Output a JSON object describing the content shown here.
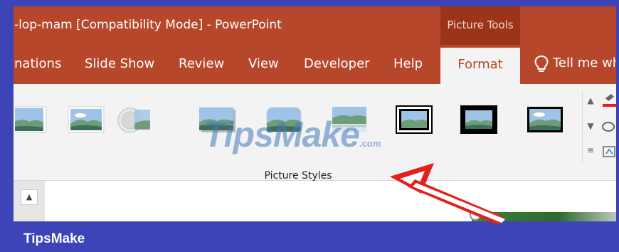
{
  "window": {
    "title": "-lop-mam [Compatibility Mode]  -  PowerPoint"
  },
  "context_tab": {
    "label": "Picture Tools"
  },
  "tabs": [
    {
      "label": "nations"
    },
    {
      "label": "Slide Show"
    },
    {
      "label": "Review"
    },
    {
      "label": "View"
    },
    {
      "label": "Developer"
    },
    {
      "label": "Help"
    }
  ],
  "active_tab": {
    "label": "Format"
  },
  "tell_me": {
    "label": "Tell me wh"
  },
  "ribbon": {
    "group_label": "Picture Styles",
    "styles": [
      {
        "name": "simple-frame-partial"
      },
      {
        "name": "simple-frame-white"
      },
      {
        "name": "beveled-matte"
      },
      {
        "name": "drop-shadow"
      },
      {
        "name": "rounded-diagonal"
      },
      {
        "name": "reflected"
      },
      {
        "name": "double-frame-black"
      },
      {
        "name": "thick-matte-black"
      },
      {
        "name": "simple-frame-black"
      }
    ]
  },
  "watermark": {
    "text": "TipsMake",
    "suffix": ".com"
  },
  "brand": {
    "text": "TipsMake"
  },
  "colors": {
    "accent": "#b7472a",
    "border": "#3d44b8",
    "annotation": "#e3201b"
  },
  "icons": {
    "tell_me": "lightbulb-icon",
    "gallery_up": "chevron-up-icon",
    "gallery_down": "chevron-down-icon",
    "gallery_more": "more-icon",
    "slide_scroll": "scroll-up-icon"
  }
}
